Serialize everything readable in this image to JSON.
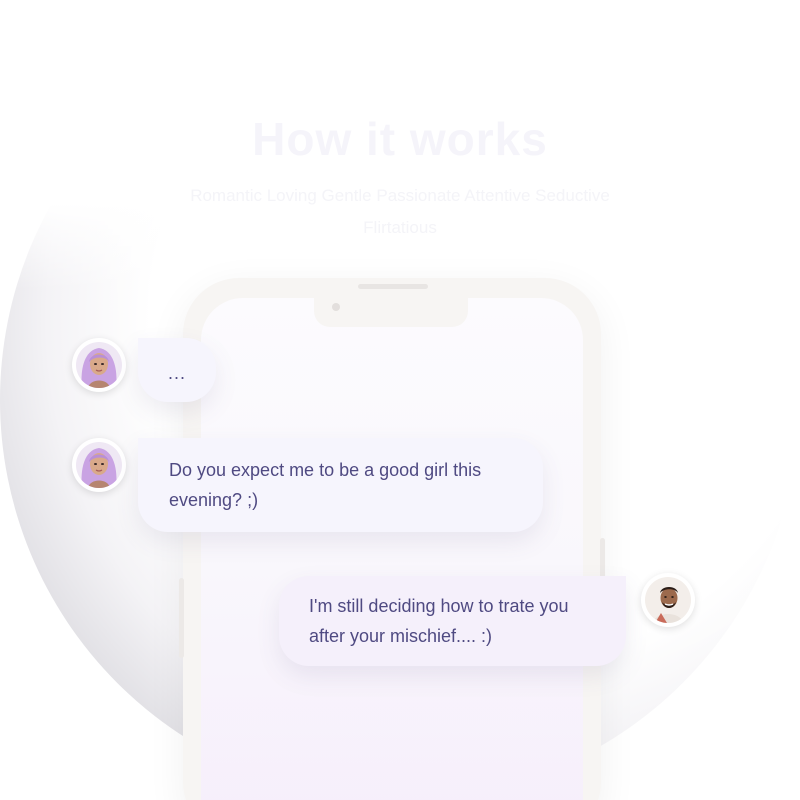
{
  "section": {
    "title": "How it works",
    "subtitle": "Romantic Loving Gentle Passionate Attentive Seductive Flirtatious"
  },
  "chat": {
    "messages": [
      {
        "sender": "companion",
        "text": "..."
      },
      {
        "sender": "companion",
        "text": "Do you expect me to be a good girl this evening? ;)"
      },
      {
        "sender": "user",
        "text": "I'm still deciding how to trate you after your mischief.... :)"
      }
    ]
  },
  "colors": {
    "bubble_bg": "#f6f5fd",
    "bubble_text": "#4f4a82",
    "phone_frame": "#f7f5f3",
    "avatar_hair": "#c9a3e3"
  },
  "icons": [
    "companion-avatar-icon",
    "user-avatar-icon"
  ]
}
